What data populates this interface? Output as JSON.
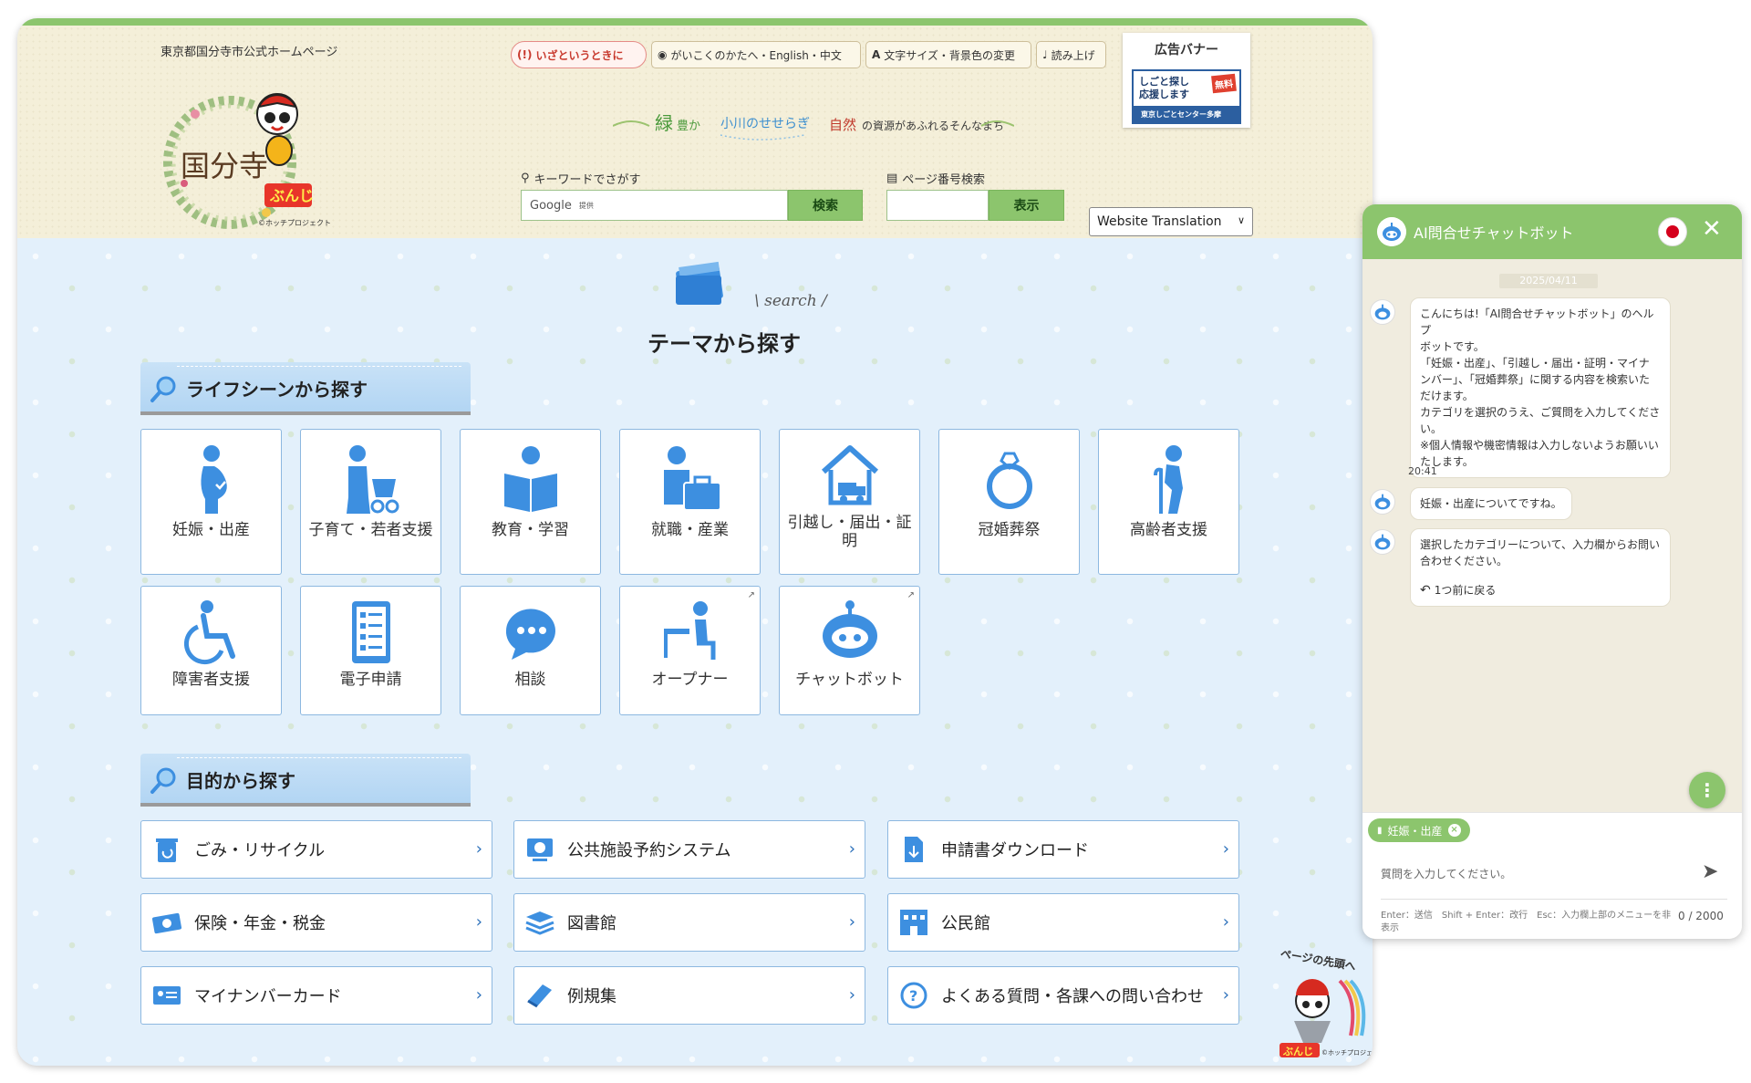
{
  "header": {
    "site_name": "東京都国分寺市公式ホームページ",
    "logo_text": "国分寺",
    "mascot_name": "ぶんじ",
    "logo_credit": "©ホッチプロジェクト",
    "util": {
      "emergency": "いざというときに",
      "foreign": "がいこくのかたへ・English・中文",
      "textsize": "文字サイズ・背景色の変更",
      "readaloud": "読み上げ"
    },
    "slogan": {
      "a": "緑",
      "b": "豊か",
      "c": "小川のせせらぎ",
      "d": "自然",
      "e": "の資源があふれるそんなまち"
    },
    "ad": {
      "title": "広告バナー",
      "line1": "しごと探し",
      "line2": "応援します",
      "free": "無料",
      "bar": "東京しごとセンター多摩"
    },
    "keyword_label": "キーワードでさがす",
    "keyword_field": "Google",
    "keyword_provided": "提供",
    "search_button": "検索",
    "page_label": "ページ番号検索",
    "page_button": "表示",
    "translate": "Website Translation"
  },
  "main": {
    "search_deco": "search",
    "heading": "テーマから探す",
    "life_title": "ライフシーンから探す",
    "purpose_title": "目的から探す",
    "tiles": [
      "妊娠・出産",
      "子育て・若者支援",
      "教育・学習",
      "就職・産業",
      "引越し・届出・証明",
      "冠婚葬祭",
      "高齢者支援",
      "障害者支援",
      "電子申請",
      "相談",
      "オープナー",
      "チャットボット"
    ],
    "links": [
      "ごみ・リサイクル",
      "公共施設予約システム",
      "申請書ダウンロード",
      "保険・年金・税金",
      "図書館",
      "公民館",
      "マイナンバーカード",
      "例規集",
      "よくある質問・各課への問い合わせ"
    ],
    "to_top": "ページの先頭へ",
    "to_top_name": "ぶんじ",
    "to_top_credit": "©ホッチプロジェクト"
  },
  "chat": {
    "title": "AI問合せチャットボット",
    "date": "2025/04/11",
    "msg1": [
      "こんにちは!「AI問合せチャットボット」のヘルプ",
      "ボットです。",
      "「妊娠・出産」、「引越し・届出・証明・マイナ",
      "ンバー」、「冠婚葬祭」に関する内容を検索いた",
      "だけます。",
      "カテゴリを選択のうえ、ご質問を入力してくださ",
      "い。",
      "※個人情報や機密情報は入力しないようお願いい",
      "たします。"
    ],
    "time": "20:41",
    "msg2": "妊娠・出産についてですね。",
    "msg3": [
      "選択したカテゴリーについて、入力欄からお問い",
      "合わせください。"
    ],
    "back": "1つ前に戻る",
    "chip": "妊娠・出産",
    "input_placeholder": "質問を入力してください。",
    "hint": "Enter：送信　Shift + Enter：改行　Esc：入力欄上部のメニューを非表示",
    "count": "0 / 2000"
  },
  "colors": {
    "green": "#8cc56d",
    "blue_icon": "#3d8fe0",
    "tile_border": "#8db8e0"
  }
}
